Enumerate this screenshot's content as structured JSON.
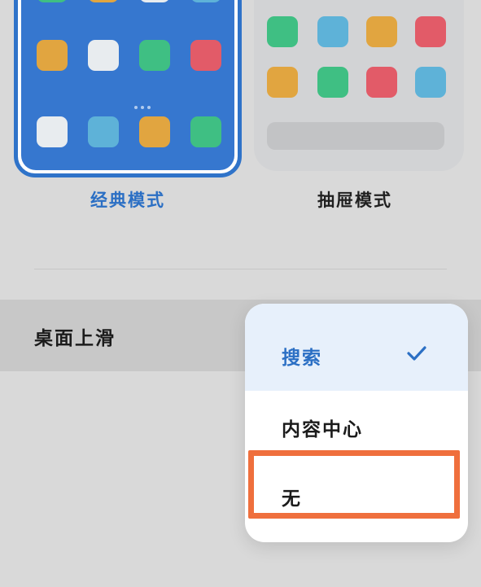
{
  "layout_modes": [
    {
      "label": "经典模式",
      "selected": true
    },
    {
      "label": "抽屉模式",
      "selected": false
    }
  ],
  "setting": {
    "label": "桌面上滑"
  },
  "dropdown": {
    "options": [
      {
        "label": "搜索",
        "selected": true
      },
      {
        "label": "内容中心",
        "selected": false
      },
      {
        "label": "无",
        "selected": false
      }
    ]
  },
  "colors": {
    "accent": "#2b6fc4",
    "highlight": "#ef6f3d",
    "tile_green": "#3fbf83",
    "tile_orange": "#e1a540",
    "tile_red": "#e25b68",
    "tile_blue": "#5eb2d8",
    "tile_white": "#e8ecef"
  }
}
